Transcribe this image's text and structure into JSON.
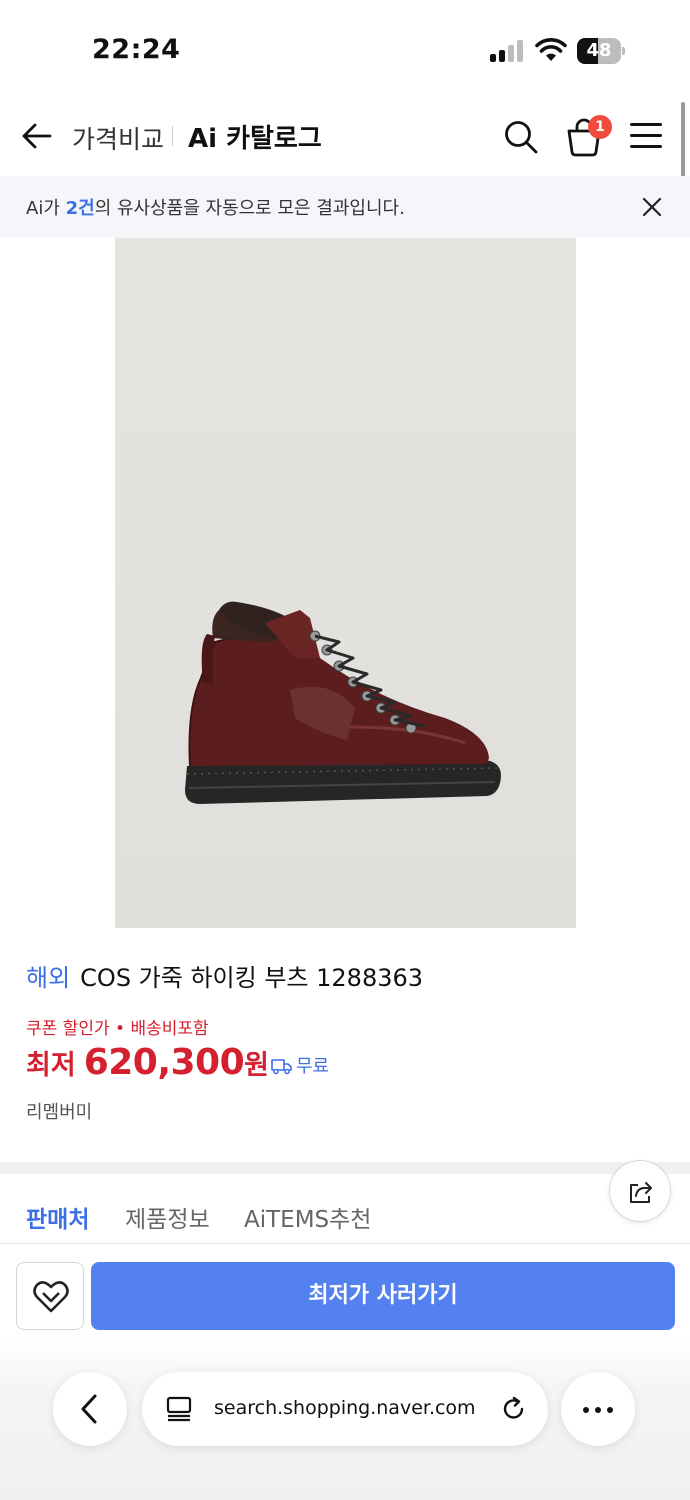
{
  "status_bar": {
    "time": "22:24",
    "battery": "48",
    "battery_level": 0.48
  },
  "header": {
    "breadcrumb": "가격비교",
    "title": "Ai 카탈로그",
    "cart_count": "1"
  },
  "notice": {
    "prefix": "Ai가 ",
    "count": "2건",
    "suffix": "의 유사상품을 자동으로 모은 결과입니다."
  },
  "product": {
    "overseas_tag": "해외",
    "name": "COS 가죽 하이킹 부츠 1288363",
    "promo": "쿠폰 할인가 • 배송비포함",
    "price_label": "최저",
    "price": "620,300",
    "price_unit": "원",
    "shipping": "무료",
    "brand": "리멤버미"
  },
  "tabs": [
    {
      "label": "판매처",
      "active": true
    },
    {
      "label": "제품정보",
      "active": false
    },
    {
      "label": "AiTEMS추천",
      "active": false
    }
  ],
  "actions": {
    "buy_label": "최저가 사러가기"
  },
  "browser": {
    "url": "search.shopping.naver.com"
  },
  "colors": {
    "accent_blue": "#3d6fe6",
    "button_blue": "#5382f0",
    "price_red": "#d4202f",
    "badge_red": "#f04b3c"
  },
  "icons": [
    "back-arrow-icon",
    "search-icon",
    "cart-icon",
    "menu-icon",
    "close-icon",
    "truck-icon",
    "share-icon",
    "heart-icon",
    "chevron-left-icon",
    "tabs-icon",
    "reload-icon",
    "more-icon"
  ]
}
